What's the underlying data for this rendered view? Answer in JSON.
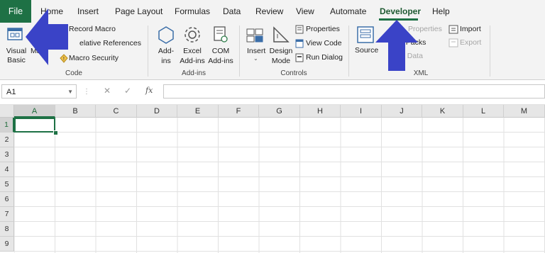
{
  "tabs": [
    "File",
    "Home",
    "Insert",
    "Page Layout",
    "Formulas",
    "Data",
    "Review",
    "View",
    "Automate",
    "Developer",
    "Help"
  ],
  "active_tab": "Developer",
  "ribbon": {
    "code": {
      "visual_basic": [
        "Visual",
        "Basic"
      ],
      "macros": "Ma",
      "record_macro": "Record Macro",
      "relative_references": "elative References",
      "macro_security": "Macro Security",
      "group_label": "Code"
    },
    "addins": {
      "addins": [
        "Add-",
        "ins"
      ],
      "excel_addins": [
        "Excel",
        "Add-ins"
      ],
      "com_addins": [
        "COM",
        "Add-ins"
      ],
      "group_label": "Add-ins"
    },
    "controls": {
      "insert": "Insert",
      "design_mode": [
        "Design",
        "Mode"
      ],
      "properties": "Properties",
      "view_code": "View Code",
      "run_dialog": "Run Dialog",
      "group_label": "Controls"
    },
    "xml": {
      "source": "Source",
      "map_properties": "Properties",
      "expansion_packs": "n Packs",
      "refresh_data": "h Data",
      "import": "Import",
      "export": "Export",
      "group_label": "XML"
    }
  },
  "formula_bar": {
    "name_box": "A1",
    "fx": "fx",
    "cancel": "✕",
    "enter": "✓",
    "more": "⋮"
  },
  "grid": {
    "columns": [
      "A",
      "B",
      "C",
      "D",
      "E",
      "F",
      "G",
      "H",
      "I",
      "J",
      "K",
      "L",
      "M"
    ],
    "rows": [
      "1",
      "2",
      "3",
      "4",
      "5",
      "6",
      "7",
      "8",
      "9"
    ],
    "selected_cell": "A1"
  },
  "colors": {
    "excel_green": "#1e7145",
    "annotation_arrow": "#3a43c7"
  }
}
